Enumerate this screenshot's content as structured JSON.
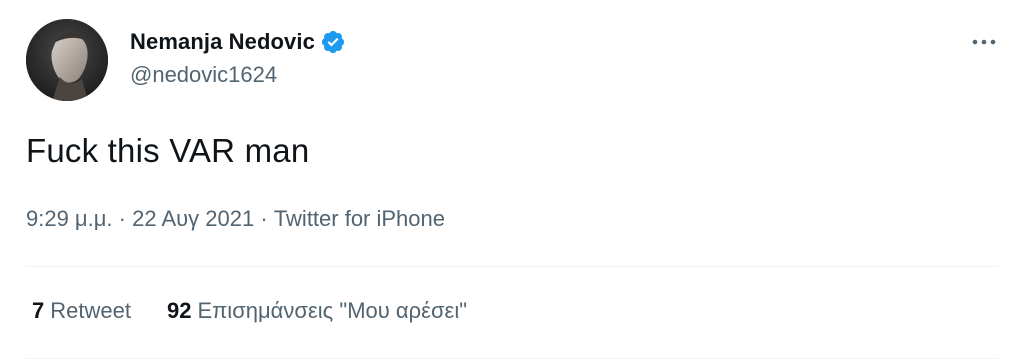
{
  "author": {
    "display_name": "Nemanja Nedovic",
    "handle": "@nedovic1624",
    "verified": true,
    "verified_color": "#1d9bf0"
  },
  "tweet": {
    "text": "Fuck this VAR man",
    "time": "9:29 μ.μ.",
    "separator1": "·",
    "date": "22 Αυγ 2021",
    "separator2": "·",
    "source": "Twitter for iPhone"
  },
  "stats": {
    "retweets_count": "7",
    "retweets_label": "Retweet",
    "likes_count": "92",
    "likes_label": "Επισημάνσεις \"Μου αρέσει\""
  },
  "icons": {
    "more": "more-horizontal-icon",
    "verified": "verified-badge-icon"
  },
  "colors": {
    "text_primary": "#0f1419",
    "text_secondary": "#536471",
    "divider": "#eff3f4"
  }
}
